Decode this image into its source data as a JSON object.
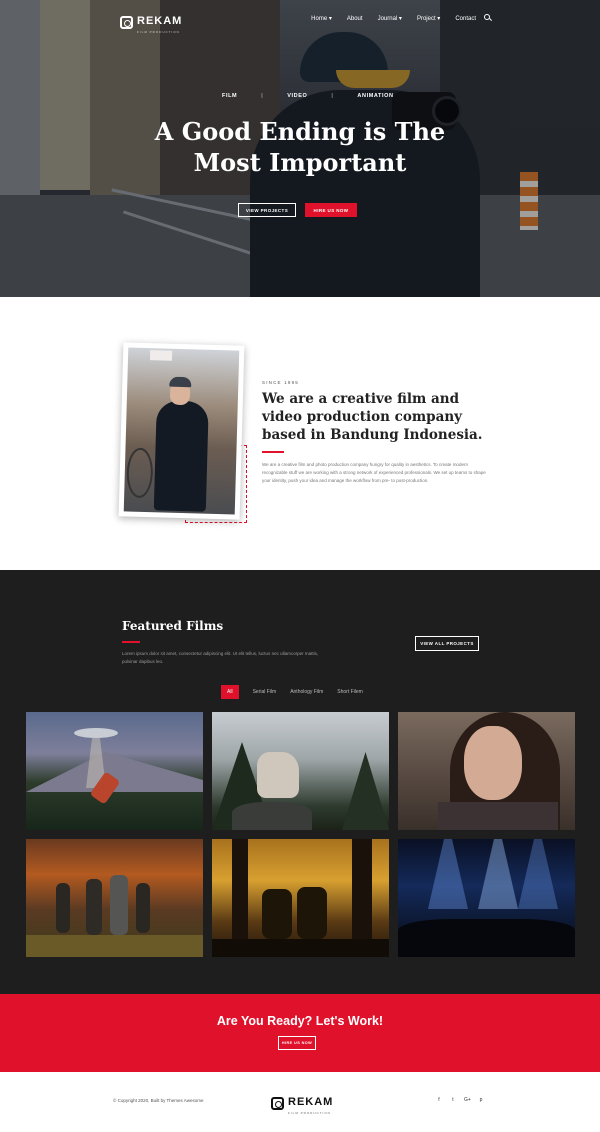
{
  "brand": {
    "name": "REKAM",
    "tagline": "FILM PRODUCTION"
  },
  "nav": {
    "items": [
      "Home",
      "About",
      "Journal",
      "Project",
      "Contact"
    ]
  },
  "hero": {
    "categories": [
      "FILM",
      "VIDEO",
      "ANIMATION"
    ],
    "title_line1": "A Good Ending is The",
    "title_line2": "Most Important",
    "view_projects": "VIEW PROJECTS",
    "hire_us": "HIRE US NOW"
  },
  "about": {
    "since": "SINCE 1995",
    "title": "We are a creative film and video production company based in Bandung Indonesia.",
    "text": "We are a creative film and photo production company hungry for quality in aesthetics. To create modern recognizable stuff we are working with a strong network of experienced professionals. We set up teams to shape your identity, push your idea and manage the workflow from pre- to post-production."
  },
  "featured": {
    "title": "Featured Films",
    "text": "Lorem ipsum dolor sit amet, consectetur adipiscing elit. Ut elit tellus, luctus nec ullamcorper mattis, pulvinar dapibus leo.",
    "view_all": "VIEW ALL PROJECTS",
    "filters": [
      "All",
      "Serial Film",
      "Anthology Film",
      "Short Filem"
    ]
  },
  "cta": {
    "title": "Are You Ready? Let's Work!",
    "button": "HIRE US NOW"
  },
  "footer": {
    "copyright": "© Copyright 2020, Built by Themes Awesome",
    "social": [
      "f",
      "t",
      "G+",
      "p"
    ]
  },
  "colors": {
    "accent": "#e0112b",
    "dark": "#1e1e1e"
  }
}
